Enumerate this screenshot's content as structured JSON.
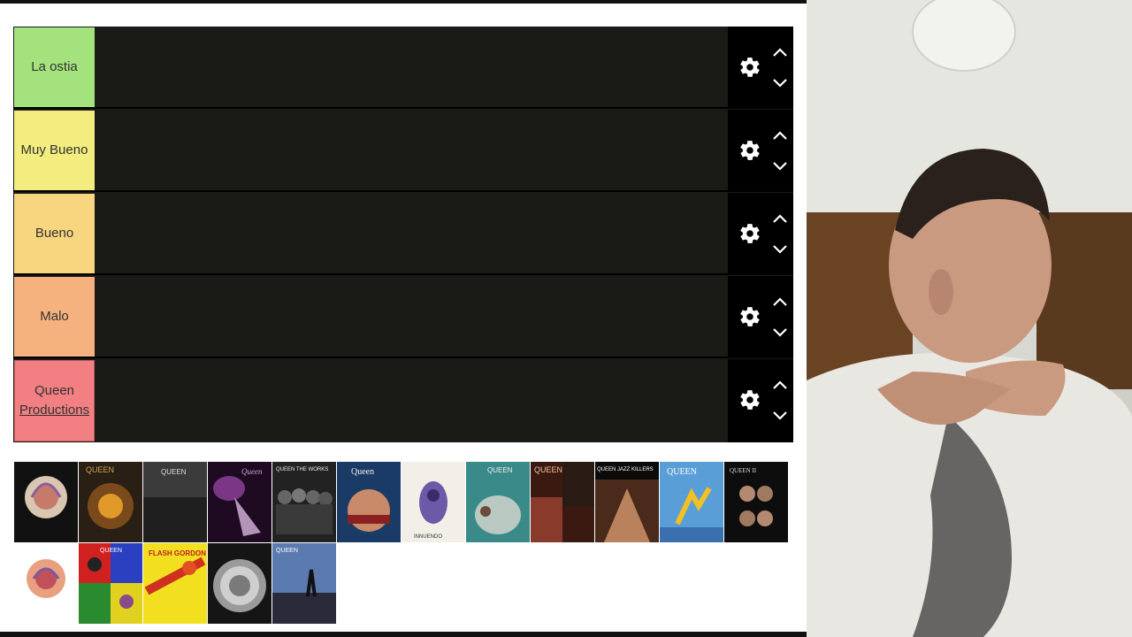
{
  "tiers": [
    {
      "label": "La ostia",
      "color": "#a4e27d"
    },
    {
      "label": "Muy Bueno",
      "color": "#f3ec7f"
    },
    {
      "label": "Bueno",
      "color": "#f8d57f"
    },
    {
      "label": "Malo",
      "color": "#f6b27e"
    },
    {
      "label_line1": "Queen",
      "label_line2": "Productions",
      "color": "#f27f82"
    }
  ],
  "controls": {
    "settings_icon": "gear-icon",
    "move_up_icon": "chevron-up-icon",
    "move_down_icon": "chevron-down-icon"
  },
  "covers": [
    {
      "name": "album-cover-1",
      "text": ""
    },
    {
      "name": "album-cover-2",
      "text": "QUEEN"
    },
    {
      "name": "album-cover-3",
      "text": "QUEEN"
    },
    {
      "name": "album-cover-4",
      "text": "Queen"
    },
    {
      "name": "album-cover-5",
      "text": "QUEEN   THE WORKS"
    },
    {
      "name": "album-cover-6",
      "text": "Queen"
    },
    {
      "name": "album-cover-7",
      "text": "INNUENDO"
    },
    {
      "name": "album-cover-8",
      "text": "QUEEN"
    },
    {
      "name": "album-cover-9",
      "text": "QUEEN"
    },
    {
      "name": "album-cover-10",
      "text": "QUEEN  JAZZ  KILLERS"
    },
    {
      "name": "album-cover-11",
      "text": "QUEEN"
    },
    {
      "name": "album-cover-12",
      "text": "QUEEN II"
    },
    {
      "name": "album-cover-13",
      "text": ""
    },
    {
      "name": "album-cover-14",
      "text": "QUEEN"
    },
    {
      "name": "album-cover-15",
      "text": "FLASH GORDON"
    },
    {
      "name": "album-cover-16",
      "text": ""
    },
    {
      "name": "album-cover-17",
      "text": "QUEEN"
    }
  ],
  "colors": {
    "tier_background": "#1a1a17",
    "controls_background": "#000000",
    "page_background": "#ffffff"
  }
}
